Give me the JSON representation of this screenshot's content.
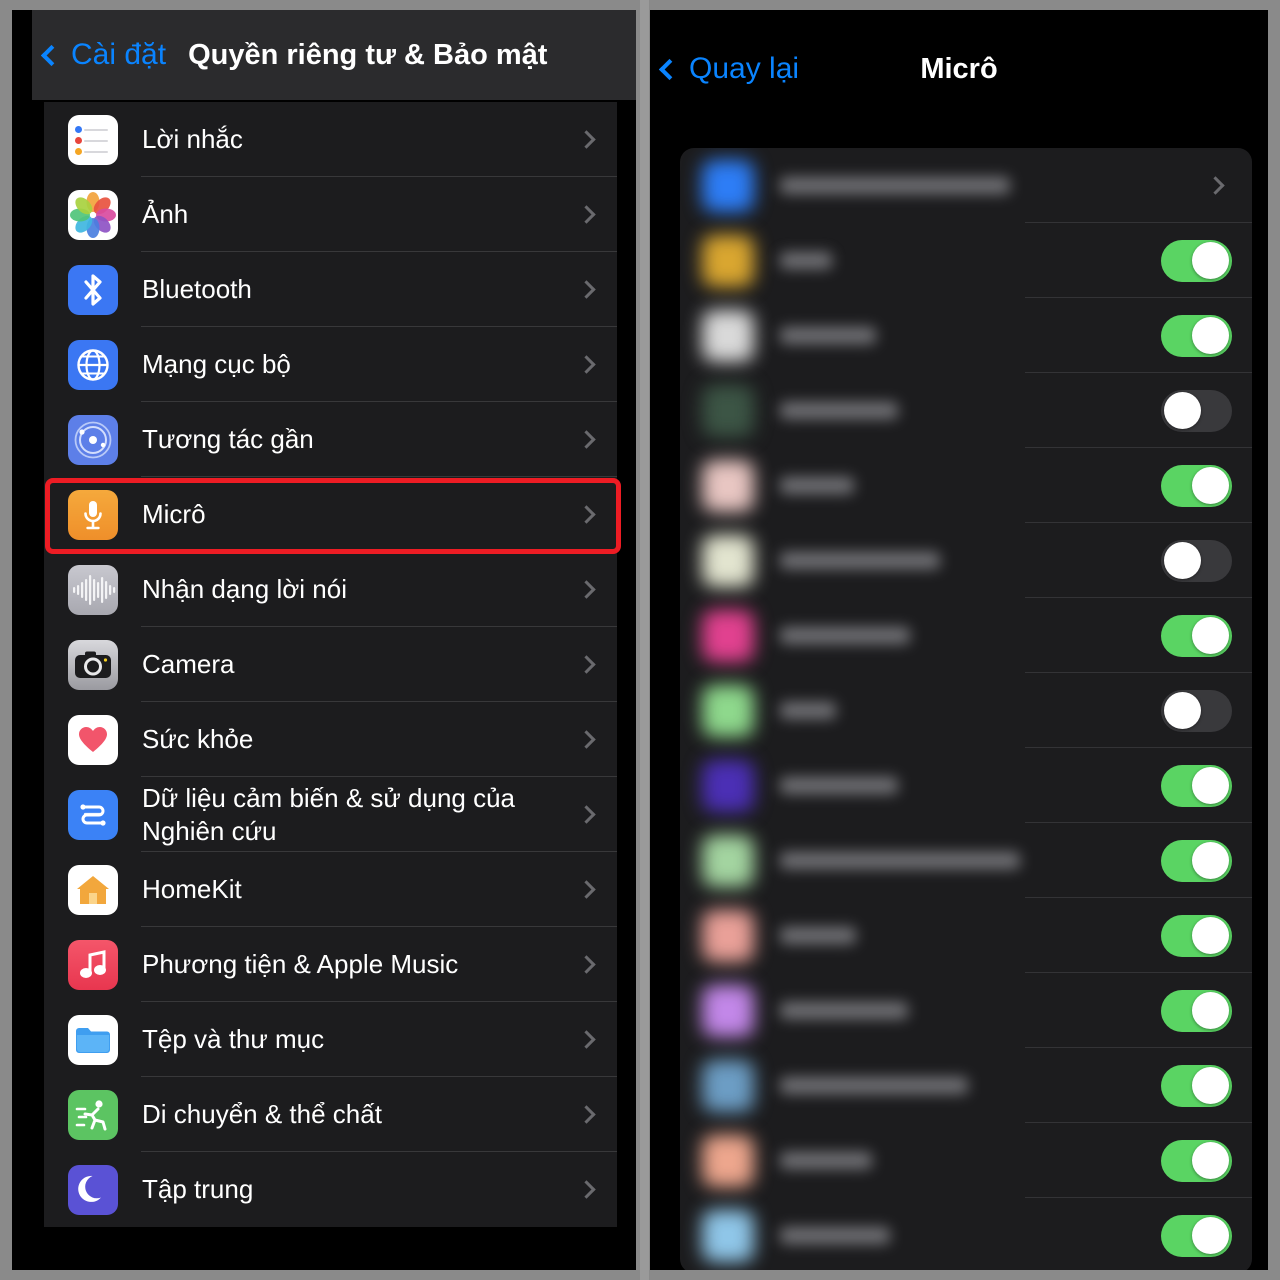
{
  "left_screen": {
    "nav": {
      "back_label": "Cài đặt",
      "back_icon": "chevron-left-icon",
      "title": "Quyền riêng tư & Bảo mật"
    },
    "items": [
      {
        "label": "Lời nhắc",
        "icon": "reminders-icon",
        "chevron": "chevron-right-icon"
      },
      {
        "label": "Ảnh",
        "icon": "photos-icon",
        "chevron": "chevron-right-icon"
      },
      {
        "label": "Bluetooth",
        "icon": "bluetooth-icon",
        "chevron": "chevron-right-icon"
      },
      {
        "label": "Mạng cục bộ",
        "icon": "globe-icon",
        "chevron": "chevron-right-icon"
      },
      {
        "label": "Tương tác gần",
        "icon": "nearby-icon",
        "chevron": "chevron-right-icon"
      },
      {
        "label": "Micrô",
        "icon": "microphone-icon",
        "chevron": "chevron-right-icon"
      },
      {
        "label": "Nhận dạng lời nói",
        "icon": "waveform-icon",
        "chevron": "chevron-right-icon"
      },
      {
        "label": "Camera",
        "icon": "camera-icon",
        "chevron": "chevron-right-icon"
      },
      {
        "label": "Sức khỏe",
        "icon": "heart-icon",
        "chevron": "chevron-right-icon"
      },
      {
        "label": "Dữ liệu cảm biến & sử dụng của Nghiên cứu",
        "icon": "research-icon",
        "chevron": "chevron-right-icon"
      },
      {
        "label": "HomeKit",
        "icon": "home-icon",
        "chevron": "chevron-right-icon"
      },
      {
        "label": "Phương tiện & Apple Music",
        "icon": "music-icon",
        "chevron": "chevron-right-icon"
      },
      {
        "label": "Tệp và thư mục",
        "icon": "folder-icon",
        "chevron": "chevron-right-icon"
      },
      {
        "label": "Di chuyển & thể chất",
        "icon": "running-icon",
        "chevron": "chevron-right-icon"
      },
      {
        "label": "Tập trung",
        "icon": "moon-icon",
        "chevron": "chevron-right-icon"
      }
    ],
    "highlight": {
      "target_label": "Micrô",
      "color": "#ed1c24"
    }
  },
  "right_screen": {
    "nav": {
      "back_label": "Quay lại",
      "back_icon": "chevron-left-icon",
      "title": "Micrô"
    },
    "note": "App names are blurred for privacy in this screenshot",
    "rows": [
      {
        "label": "",
        "icon_color": "#2d7df6",
        "control": "chevron",
        "state": "",
        "label_width": 230
      },
      {
        "label": "",
        "icon_color": "#d9a630",
        "control": "toggle",
        "state": "on",
        "label_width": 52
      },
      {
        "label": "",
        "icon_color": "#d9d9d9",
        "control": "toggle",
        "state": "on",
        "label_width": 96
      },
      {
        "label": "",
        "icon_color": "#3c5545",
        "control": "toggle",
        "state": "off",
        "label_width": 118
      },
      {
        "label": "",
        "icon_color": "#e8c6c2",
        "control": "toggle",
        "state": "on",
        "label_width": 74
      },
      {
        "label": "",
        "icon_color": "#e2e4cf",
        "control": "toggle",
        "state": "off",
        "label_width": 160
      },
      {
        "label": "",
        "icon_color": "#e1418f",
        "control": "toggle",
        "state": "on",
        "label_width": 130
      },
      {
        "label": "",
        "icon_color": "#8ed88c",
        "control": "toggle",
        "state": "off",
        "label_width": 56
      },
      {
        "label": "",
        "icon_color": "#4b2fb5",
        "control": "toggle",
        "state": "on",
        "label_width": 118
      },
      {
        "label": "",
        "icon_color": "#a3d4a0",
        "control": "toggle",
        "state": "on",
        "label_width": 240
      },
      {
        "label": "",
        "icon_color": "#e9a098",
        "control": "toggle",
        "state": "on",
        "label_width": 76
      },
      {
        "label": "",
        "icon_color": "#c287e8",
        "control": "toggle",
        "state": "on",
        "label_width": 128
      },
      {
        "label": "",
        "icon_color": "#6c9dc4",
        "control": "toggle",
        "state": "on",
        "label_width": 188
      },
      {
        "label": "",
        "icon_color": "#eda68d",
        "control": "toggle",
        "state": "on",
        "label_width": 92
      },
      {
        "label": "",
        "icon_color": "#8fc6e8",
        "control": "toggle",
        "state": "on",
        "label_width": 110
      }
    ]
  },
  "colors": {
    "frame": "#8a8a8a",
    "screen_bg": "#000000",
    "list_bg": "#1c1c1e",
    "accent_blue": "#0a84ff",
    "toggle_on": "#5ad463",
    "toggle_off": "#39393c",
    "highlight_red": "#ed1c24"
  }
}
